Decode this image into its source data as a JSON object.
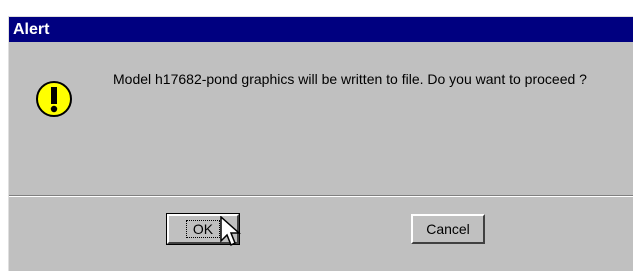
{
  "window": {
    "title": "Alert"
  },
  "message": {
    "text": "Model h17682-pond graphics will be written to file. Do you want to proceed ?"
  },
  "icon": {
    "name": "warning-exclamation-icon",
    "color": "#ffff00"
  },
  "buttons": {
    "ok_label": "OK",
    "cancel_label": "Cancel"
  },
  "colors": {
    "titlebar": "#000080",
    "dialog_bg": "#c0c0c0"
  }
}
